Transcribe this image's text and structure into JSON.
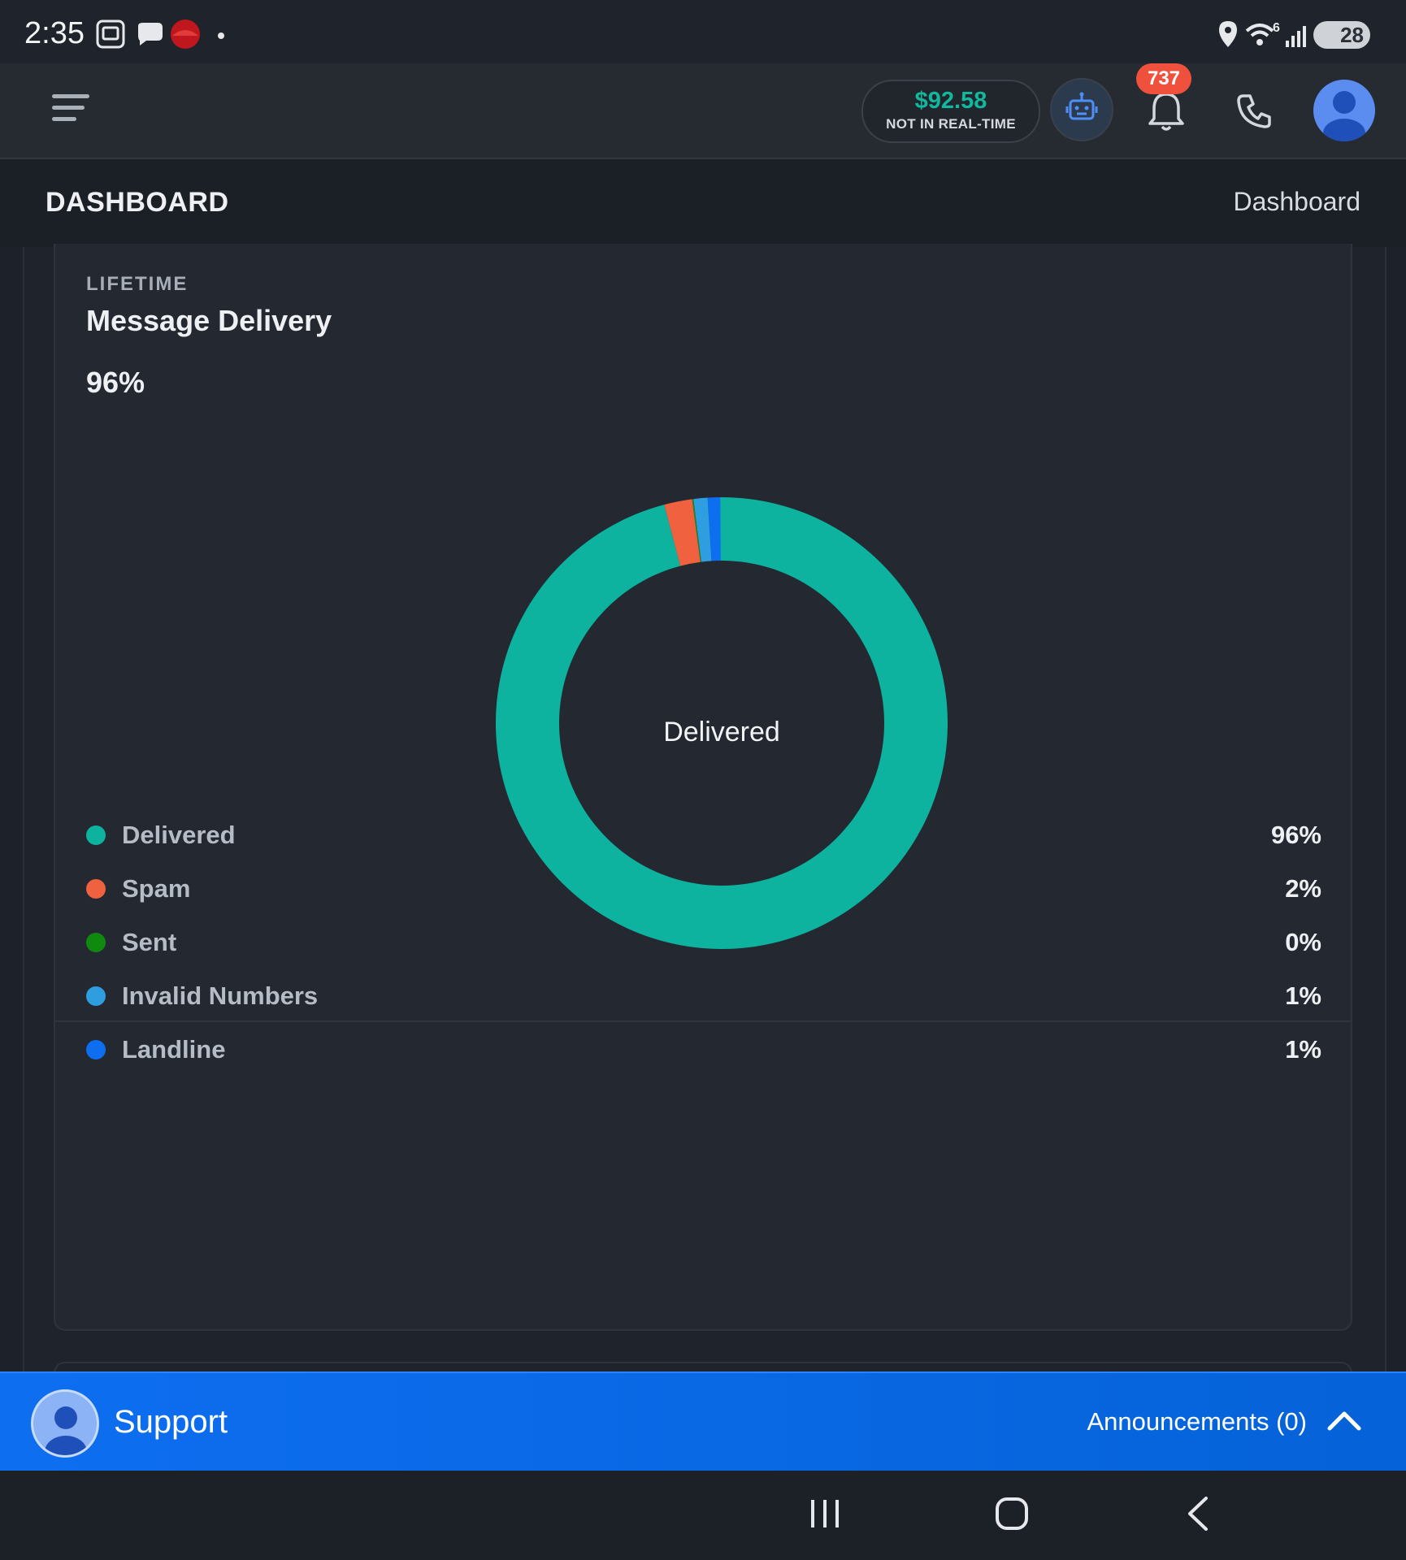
{
  "status_bar": {
    "time": "2:35",
    "battery": "28",
    "wifi_badge": "6",
    "icons": [
      "screenshot-icon",
      "chat-icon",
      "app-red-icon",
      "location-icon",
      "wifi-icon",
      "signal-icon",
      "battery-icon"
    ]
  },
  "header": {
    "balance_amount": "$92.58",
    "balance_subtitle": "NOT IN REAL-TIME",
    "notification_count": "737",
    "icons": [
      "menu-icon",
      "robot-icon",
      "bell-icon",
      "phone-icon",
      "user-avatar-icon"
    ]
  },
  "page": {
    "title": "DASHBOARD",
    "breadcrumb": "Dashboard"
  },
  "card": {
    "kicker": "LIFETIME",
    "title": "Message Delivery",
    "headline_value": "96%",
    "center_label": "Delivered"
  },
  "chart_data": {
    "type": "pie",
    "donut": true,
    "center_label": "Delivered",
    "categories": [
      "Delivered",
      "Spam",
      "Sent",
      "Invalid Numbers",
      "Landline"
    ],
    "values": [
      96,
      2,
      0,
      1,
      1
    ],
    "value_labels": [
      "96%",
      "2%",
      "0%",
      "1%",
      "1%"
    ],
    "colors": [
      "#0db39e",
      "#f0613f",
      "#1a8a1a",
      "#2e9ee0",
      "#0d6ef0"
    ],
    "legend_position": "bottom"
  },
  "legend": [
    {
      "label": "Delivered",
      "value": "96%",
      "color": "#0db39e"
    },
    {
      "label": "Spam",
      "value": "2%",
      "color": "#f0613f"
    },
    {
      "label": "Sent",
      "value": "0%",
      "color": "#0f8a0f"
    },
    {
      "label": "Invalid Numbers",
      "value": "1%",
      "color": "#2e9ee0"
    },
    {
      "label": "Landline",
      "value": "1%",
      "color": "#0d6ef0"
    }
  ],
  "support_bar": {
    "label": "Support",
    "announcements": "Announcements (0)"
  },
  "nav": {
    "icons": [
      "recent-apps-icon",
      "home-icon",
      "back-icon"
    ]
  },
  "colors": {
    "accent_green": "#12b89c",
    "support_blue": "#0d6ef0",
    "badge_red": "#f0513d"
  }
}
